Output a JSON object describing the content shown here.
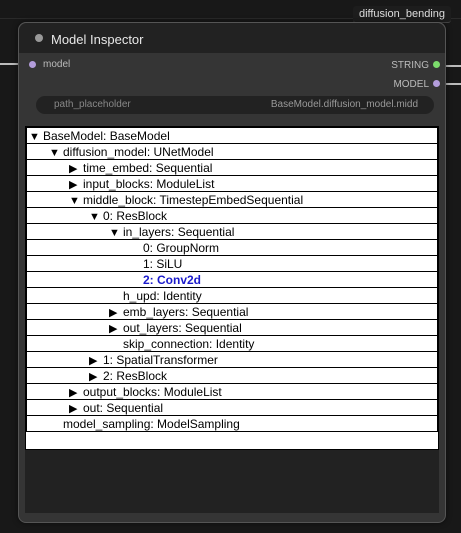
{
  "canvas": {
    "tag_label": "diffusion_bending"
  },
  "node": {
    "title": "Model Inspector",
    "inputs": [
      {
        "label": "model",
        "color": "#b39ddb"
      }
    ],
    "outputs": [
      {
        "label": "STRING",
        "color": "#7cdc6c"
      },
      {
        "label": "MODEL",
        "color": "#b39ddb"
      }
    ],
    "widget": {
      "placeholder": "path_placeholder",
      "value": "BaseModel.diffusion_model.midd"
    }
  },
  "tree": [
    {
      "label": "BaseModel: BaseModel",
      "toggle": "expanded",
      "selected": false
    },
    {
      "label": "diffusion_model: UNetModel",
      "toggle": "expanded",
      "selected": false
    },
    {
      "label": "time_embed: Sequential",
      "toggle": "collapsed",
      "selected": false
    },
    {
      "label": "input_blocks: ModuleList",
      "toggle": "collapsed",
      "selected": false
    },
    {
      "label": "middle_block: TimestepEmbedSequential",
      "toggle": "expanded",
      "selected": false
    },
    {
      "label": "0: ResBlock",
      "toggle": "expanded",
      "selected": false
    },
    {
      "label": "in_layers: Sequential",
      "toggle": "expanded",
      "selected": false
    },
    {
      "label": "0: GroupNorm",
      "toggle": "none",
      "selected": false
    },
    {
      "label": "1: SiLU",
      "toggle": "none",
      "selected": false
    },
    {
      "label": "2: Conv2d",
      "toggle": "none",
      "selected": true
    },
    {
      "label": "h_upd: Identity",
      "toggle": "none",
      "selected": false
    },
    {
      "label": "emb_layers: Sequential",
      "toggle": "collapsed",
      "selected": false
    },
    {
      "label": "out_layers: Sequential",
      "toggle": "collapsed",
      "selected": false
    },
    {
      "label": "skip_connection: Identity",
      "toggle": "none",
      "selected": false
    },
    {
      "label": "1: SpatialTransformer",
      "toggle": "collapsed",
      "selected": false
    },
    {
      "label": "2: ResBlock",
      "toggle": "collapsed",
      "selected": false
    },
    {
      "label": "output_blocks: ModuleList",
      "toggle": "collapsed",
      "selected": false
    },
    {
      "label": "out: Sequential",
      "toggle": "collapsed",
      "selected": false
    },
    {
      "label": "model_sampling: ModelSampling",
      "toggle": "none",
      "selected": false
    }
  ]
}
